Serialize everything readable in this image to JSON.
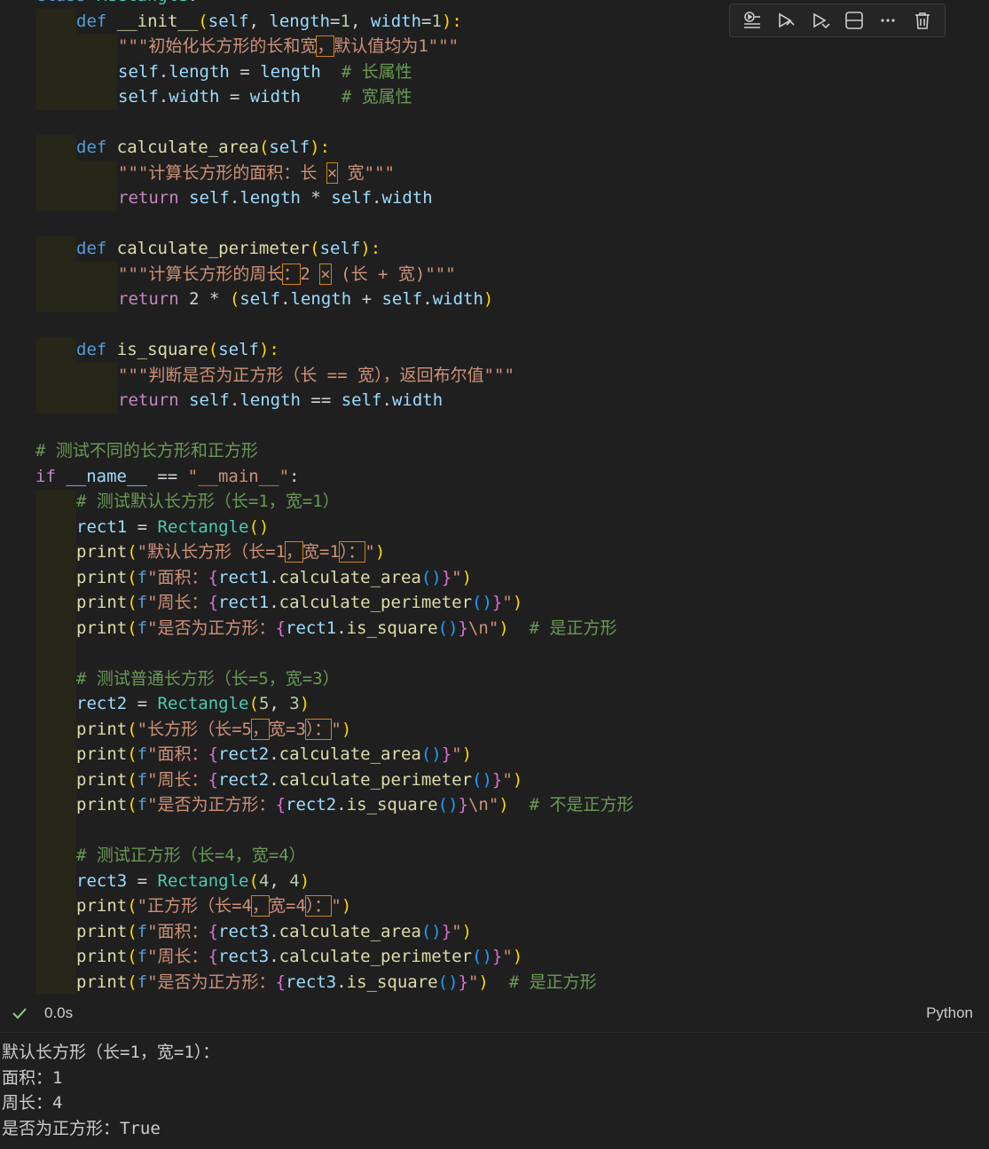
{
  "toolbar": {
    "buttons": [
      {
        "name": "run-by-line",
        "icon": "run-by-line-icon"
      },
      {
        "name": "execute-above",
        "icon": "execute-above-icon"
      },
      {
        "name": "execute-below",
        "icon": "execute-below-icon"
      },
      {
        "name": "split-cell",
        "icon": "split-cell-icon"
      },
      {
        "name": "more-actions",
        "icon": "more-icon"
      },
      {
        "name": "delete-cell",
        "icon": "trash-icon"
      }
    ]
  },
  "code": {
    "l1": {
      "a": "def",
      "b": "__init__",
      "c": "(",
      "d": "self",
      "e": ", ",
      "f": "length",
      "g": "=",
      "h": "1",
      "i": ", ",
      "j": "width",
      "k": "=",
      "l": "1",
      "m": "):"
    },
    "l2": {
      "a": "\"\"\"初始化长方形的长和宽",
      "b": "，",
      "c": "默认值均为1\"\"\""
    },
    "l3": {
      "a": "self",
      "b": ".",
      "c": "length",
      "d": " = ",
      "e": "length",
      "f": "  # 长属性"
    },
    "l4": {
      "a": "self",
      "b": ".",
      "c": "width",
      "d": " = ",
      "e": "width",
      "f": "    # 宽属性"
    },
    "l5": {
      "a": "def",
      "b": "calculate_area",
      "c": "(",
      "d": "self",
      "e": "):"
    },
    "l6": {
      "a": "\"\"\"计算长方形的面积：长 ",
      "b": "×",
      "c": " 宽\"\"\""
    },
    "l7": {
      "a": "return",
      "b": "self",
      "c": ".",
      "d": "length",
      "e": " * ",
      "f": "self",
      "g": ".",
      "h": "width"
    },
    "l8": {
      "a": "def",
      "b": "calculate_perimeter",
      "c": "(",
      "d": "self",
      "e": "):"
    },
    "l9": {
      "a": "\"\"\"计算长方形的周长",
      "b": "：",
      "c": "2 ",
      "d": "×",
      "e": " (长 + 宽)\"\"\""
    },
    "l10": {
      "a": "return",
      "b": " 2 * ",
      "c": "(",
      "d": "self",
      "e": ".",
      "f": "length",
      "g": " + ",
      "h": "self",
      "i": ".",
      "j": "width",
      "k": ")"
    },
    "l11": {
      "a": "def",
      "b": "is_square",
      "c": "(",
      "d": "self",
      "e": "):"
    },
    "l12": {
      "a": "\"\"\"判断是否为正方形（长 == 宽），返回布尔值\"\"\""
    },
    "l13": {
      "a": "return",
      "b": "self",
      "c": ".",
      "d": "length",
      "e": " == ",
      "f": "self",
      "g": ".",
      "h": "width"
    },
    "l14": {
      "a": "# 测试不同的长方形和正方形"
    },
    "l15": {
      "a": "if",
      "b": "__name__",
      "c": " == ",
      "d": "\"__main__\"",
      "e": ":"
    },
    "l16": {
      "a": "# 测试默认长方形（长=1，宽=1）"
    },
    "l17": {
      "a": "rect1",
      "b": " = ",
      "c": "Rectangle",
      "d": "()"
    },
    "l18": {
      "a": "print",
      "b": "(",
      "c": "\"默认长方形（长=1",
      "d": "，",
      "e": "宽=1",
      "f": "）：",
      "g": "\"",
      "h": ")"
    },
    "l19": {
      "a": "print",
      "b": "(",
      "c": "f",
      "d": "\"面积：",
      "e": "{",
      "f": "rect1",
      "g": ".",
      "h": "calculate_area",
      "i": "()",
      "j": "}",
      "k": "\"",
      "l": ")"
    },
    "l20": {
      "a": "print",
      "b": "(",
      "c": "f",
      "d": "\"周长：",
      "e": "{",
      "f": "rect1",
      "g": ".",
      "h": "calculate_perimeter",
      "i": "()",
      "j": "}",
      "k": "\"",
      "l": ")"
    },
    "l21": {
      "a": "print",
      "b": "(",
      "c": "f",
      "d": "\"是否为正方形：",
      "e": "{",
      "f": "rect1",
      "g": ".",
      "h": "is_square",
      "i": "()",
      "j": "}",
      "k": "\\n\"",
      "l": ")",
      "m": "  # 是正方形"
    },
    "l22": {
      "a": "# 测试普通长方形（长=5，宽=3）"
    },
    "l23": {
      "a": "rect2",
      "b": " = ",
      "c": "Rectangle",
      "d": "(",
      "e": "5",
      "f": ", ",
      "g": "3",
      "h": ")"
    },
    "l24": {
      "a": "print",
      "b": "(",
      "c": "\"长方形（长=5",
      "d": "，",
      "e": "宽=3",
      "f": "）：",
      "g": "\"",
      "h": ")"
    },
    "l25": {
      "a": "print",
      "b": "(",
      "c": "f",
      "d": "\"面积：",
      "e": "{",
      "f": "rect2",
      "g": ".",
      "h": "calculate_area",
      "i": "()",
      "j": "}",
      "k": "\"",
      "l": ")"
    },
    "l26": {
      "a": "print",
      "b": "(",
      "c": "f",
      "d": "\"周长：",
      "e": "{",
      "f": "rect2",
      "g": ".",
      "h": "calculate_perimeter",
      "i": "()",
      "j": "}",
      "k": "\"",
      "l": ")"
    },
    "l27": {
      "a": "print",
      "b": "(",
      "c": "f",
      "d": "\"是否为正方形：",
      "e": "{",
      "f": "rect2",
      "g": ".",
      "h": "is_square",
      "i": "()",
      "j": "}",
      "k": "\\n\"",
      "l": ")",
      "m": "  # 不是正方形"
    },
    "l28": {
      "a": "# 测试正方形（长=4，宽=4）"
    },
    "l29": {
      "a": "rect3",
      "b": " = ",
      "c": "Rectangle",
      "d": "(",
      "e": "4",
      "f": ", ",
      "g": "4",
      "h": ")"
    },
    "l30": {
      "a": "print",
      "b": "(",
      "c": "\"正方形（长=4",
      "d": "，",
      "e": "宽=4",
      "f": "）：",
      "g": "\"",
      "h": ")"
    },
    "l31": {
      "a": "print",
      "b": "(",
      "c": "f",
      "d": "\"面积：",
      "e": "{",
      "f": "rect3",
      "g": ".",
      "h": "calculate_area",
      "i": "()",
      "j": "}",
      "k": "\"",
      "l": ")"
    },
    "l32": {
      "a": "print",
      "b": "(",
      "c": "f",
      "d": "\"周长：",
      "e": "{",
      "f": "rect3",
      "g": ".",
      "h": "calculate_perimeter",
      "i": "()",
      "j": "}",
      "k": "\"",
      "l": ")"
    },
    "l33": {
      "a": "print",
      "b": "(",
      "c": "f",
      "d": "\"是否为正方形：",
      "e": "{",
      "f": "rect3",
      "g": ".",
      "h": "is_square",
      "i": "()",
      "j": "}",
      "k": "\"",
      "l": ")",
      "m": "  # 是正方形"
    }
  },
  "status": {
    "time": "0.0s",
    "language": "Python"
  },
  "output": [
    "默认长方形（长=1，宽=1）：",
    "面积：1",
    "周长：4",
    "是否为正方形：True"
  ],
  "colors": {
    "background": "#1f1f1f",
    "keyword": "#569cd6",
    "function": "#dcdcaa",
    "variable": "#9cdcfe",
    "string": "#ce9178",
    "comment": "#6a9955",
    "class": "#4ec9b0",
    "success": "#89d185"
  }
}
